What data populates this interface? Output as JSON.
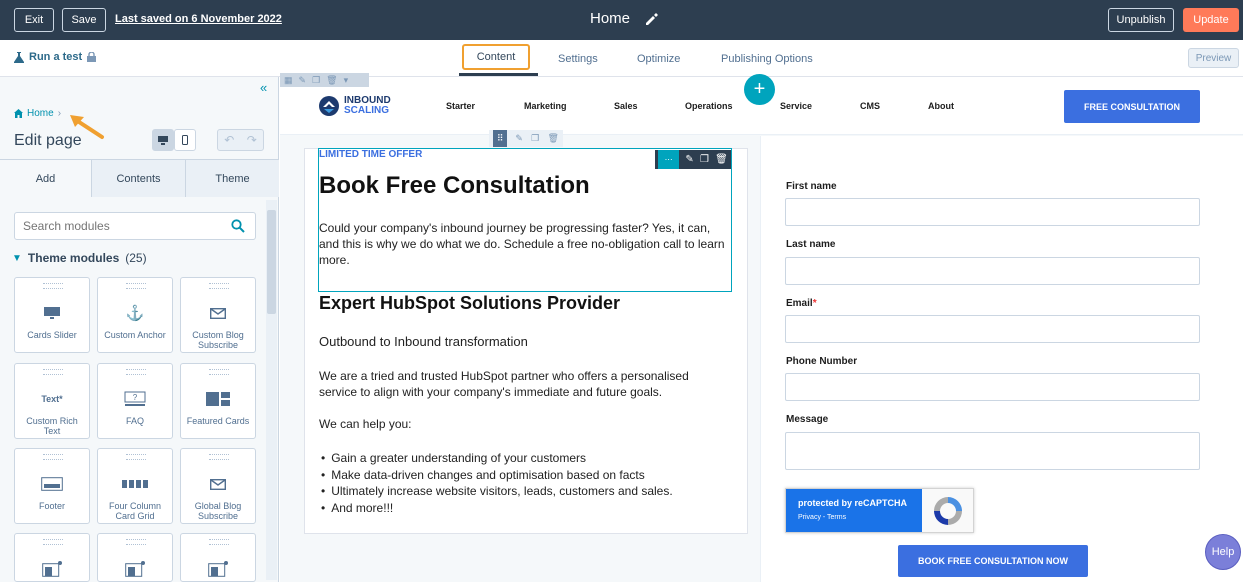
{
  "topbar": {
    "exit_label": "Exit",
    "save_label": "Save",
    "last_saved": "Last saved on 6 November 2022",
    "page_title": "Home",
    "unpublish_label": "Unpublish",
    "update_label": "Update"
  },
  "tabsbar": {
    "run_test": "Run a test",
    "tabs": [
      {
        "label": "Content",
        "active": true
      },
      {
        "label": "Settings"
      },
      {
        "label": "Optimize"
      },
      {
        "label": "Publishing Options"
      }
    ],
    "preview_label": "Preview"
  },
  "sidebar": {
    "breadcrumb": "Home",
    "heading": "Edit page",
    "tabs": [
      "Add",
      "Contents",
      "Theme"
    ],
    "search_placeholder": "Search modules",
    "section_title": "Theme modules",
    "section_count": "(25)",
    "modules": [
      {
        "label": "Cards Slider",
        "icon": "monitor-icon"
      },
      {
        "label": "Custom Anchor",
        "icon": "anchor-icon"
      },
      {
        "label": "Custom Blog Subscribe",
        "icon": "envelope-icon"
      },
      {
        "label": "Custom Rich Text",
        "icon": "text-icon",
        "icon_text": "Text*"
      },
      {
        "label": "FAQ",
        "icon": "faq-icon"
      },
      {
        "label": "Featured Cards",
        "icon": "cards-icon"
      },
      {
        "label": "Footer",
        "icon": "footer-icon"
      },
      {
        "label": "Four Column Card Grid",
        "icon": "grid-icon"
      },
      {
        "label": "Global Blog Subscribe",
        "icon": "envelope-icon"
      }
    ]
  },
  "site": {
    "logo_line1": "INBOUND",
    "logo_line2": "SCALING",
    "nav": [
      "Starter",
      "Marketing",
      "Sales",
      "Operations",
      "Service",
      "CMS",
      "About"
    ],
    "cta": "FREE CONSULTATION"
  },
  "content": {
    "offer": "LIMITED TIME OFFER",
    "headline": "Book Free Consultation",
    "intro": "Could your company's inbound journey be progressing faster? Yes, it can, and this is why we do what we do. Schedule a free no-obligation call to learn more.",
    "subhead": "Expert HubSpot Solutions Provider",
    "tagline": "Outbound to Inbound transformation",
    "body": "We are a tried and trusted HubSpot partner who offers a personalised service to align with your company's immediate and future goals.",
    "help_intro": "We can help you:",
    "bullets": [
      "Gain a greater understanding of your customers",
      "Make data-driven changes and optimisation based on facts",
      "Ultimately increase website visitors, leads, customers and sales.",
      "And more!!!"
    ]
  },
  "form": {
    "fields": [
      {
        "label": "First name",
        "required": false
      },
      {
        "label": "Last name",
        "required": false
      },
      {
        "label": "Email",
        "required": true
      },
      {
        "label": "Phone Number",
        "required": false
      },
      {
        "label": "Message",
        "required": false
      }
    ],
    "recaptcha_title": "protected by reCAPTCHA",
    "recaptcha_links": "Privacy - Terms",
    "submit": "BOOK FREE CONSULTATION NOW"
  },
  "help_label": "Help",
  "colors": {
    "topbar": "#2d3e50",
    "update": "#ff7a59",
    "accent": "#00a4bd",
    "site_blue": "#3b6fe0",
    "highlight": "#f0a030"
  }
}
